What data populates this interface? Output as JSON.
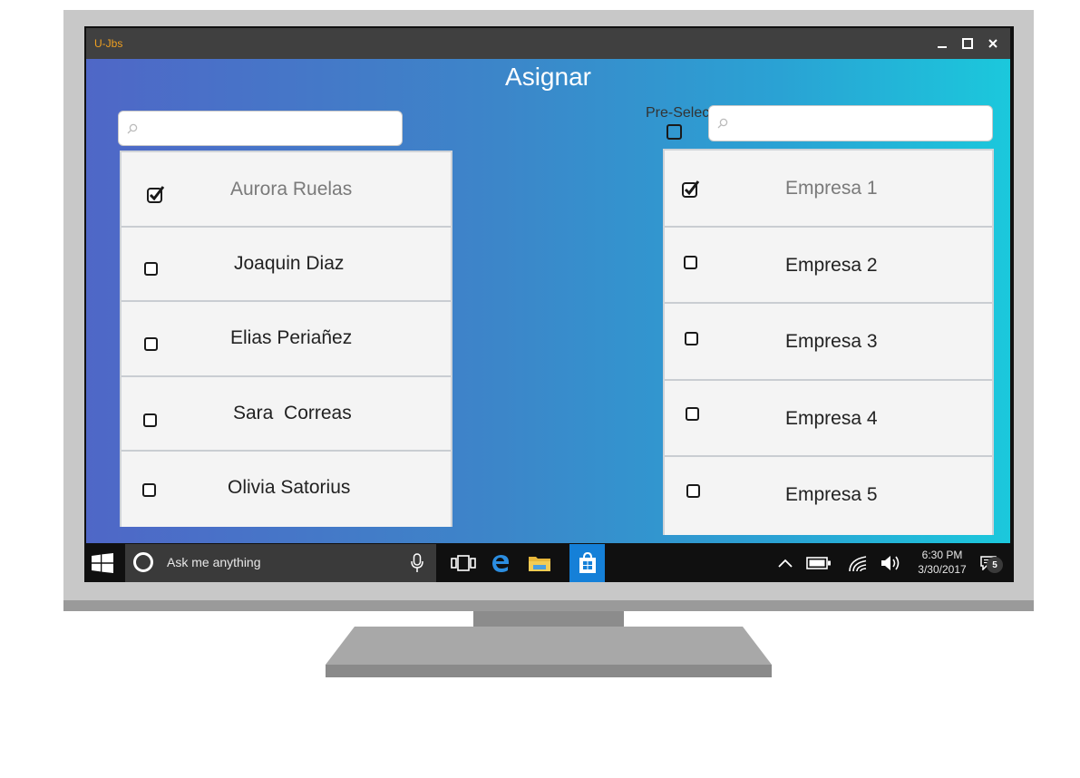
{
  "window": {
    "title": "U-Jbs",
    "controls": {
      "minimize": "_",
      "maximize": "☐",
      "close": "✕"
    }
  },
  "page": {
    "title": "Asignar"
  },
  "left_panel": {
    "search": {
      "value": "",
      "placeholder": "",
      "icon": "search-icon"
    },
    "items": [
      {
        "label": "Aurora Ruelas",
        "checked": true
      },
      {
        "label": "Joaquin Diaz",
        "checked": false
      },
      {
        "label": "Elias Periañez",
        "checked": false
      },
      {
        "label": "Sara  Correas",
        "checked": false
      },
      {
        "label": "Olivia Satorius",
        "checked": false
      }
    ]
  },
  "right_panel": {
    "preselect_label": "Pre-Selec",
    "preselect_checked": false,
    "search": {
      "value": "",
      "placeholder": "",
      "icon": "search-icon"
    },
    "items": [
      {
        "label": "Empresa 1",
        "checked": true
      },
      {
        "label": "Empresa 2",
        "checked": false
      },
      {
        "label": "Empresa 3",
        "checked": false
      },
      {
        "label": "Empresa 4",
        "checked": false
      },
      {
        "label": "Empresa 5",
        "checked": false
      }
    ]
  },
  "taskbar": {
    "search_text": "Ask me anything",
    "time": "6:30 PM",
    "date": "3/30/2017",
    "notification_count": "5",
    "icons": [
      "windows-start-icon",
      "cortana-icon",
      "microphone-icon",
      "task-view-icon",
      "edge-icon",
      "file-explorer-icon",
      "store-icon",
      "chevron-up-icon",
      "battery-icon",
      "wifi-icon",
      "volume-icon",
      "action-center-icon"
    ]
  },
  "colors": {
    "gradient_start": "#4f67c7",
    "gradient_end": "#1bc8dc",
    "title_accent": "#f0a020",
    "store_tile": "#1580d8"
  }
}
